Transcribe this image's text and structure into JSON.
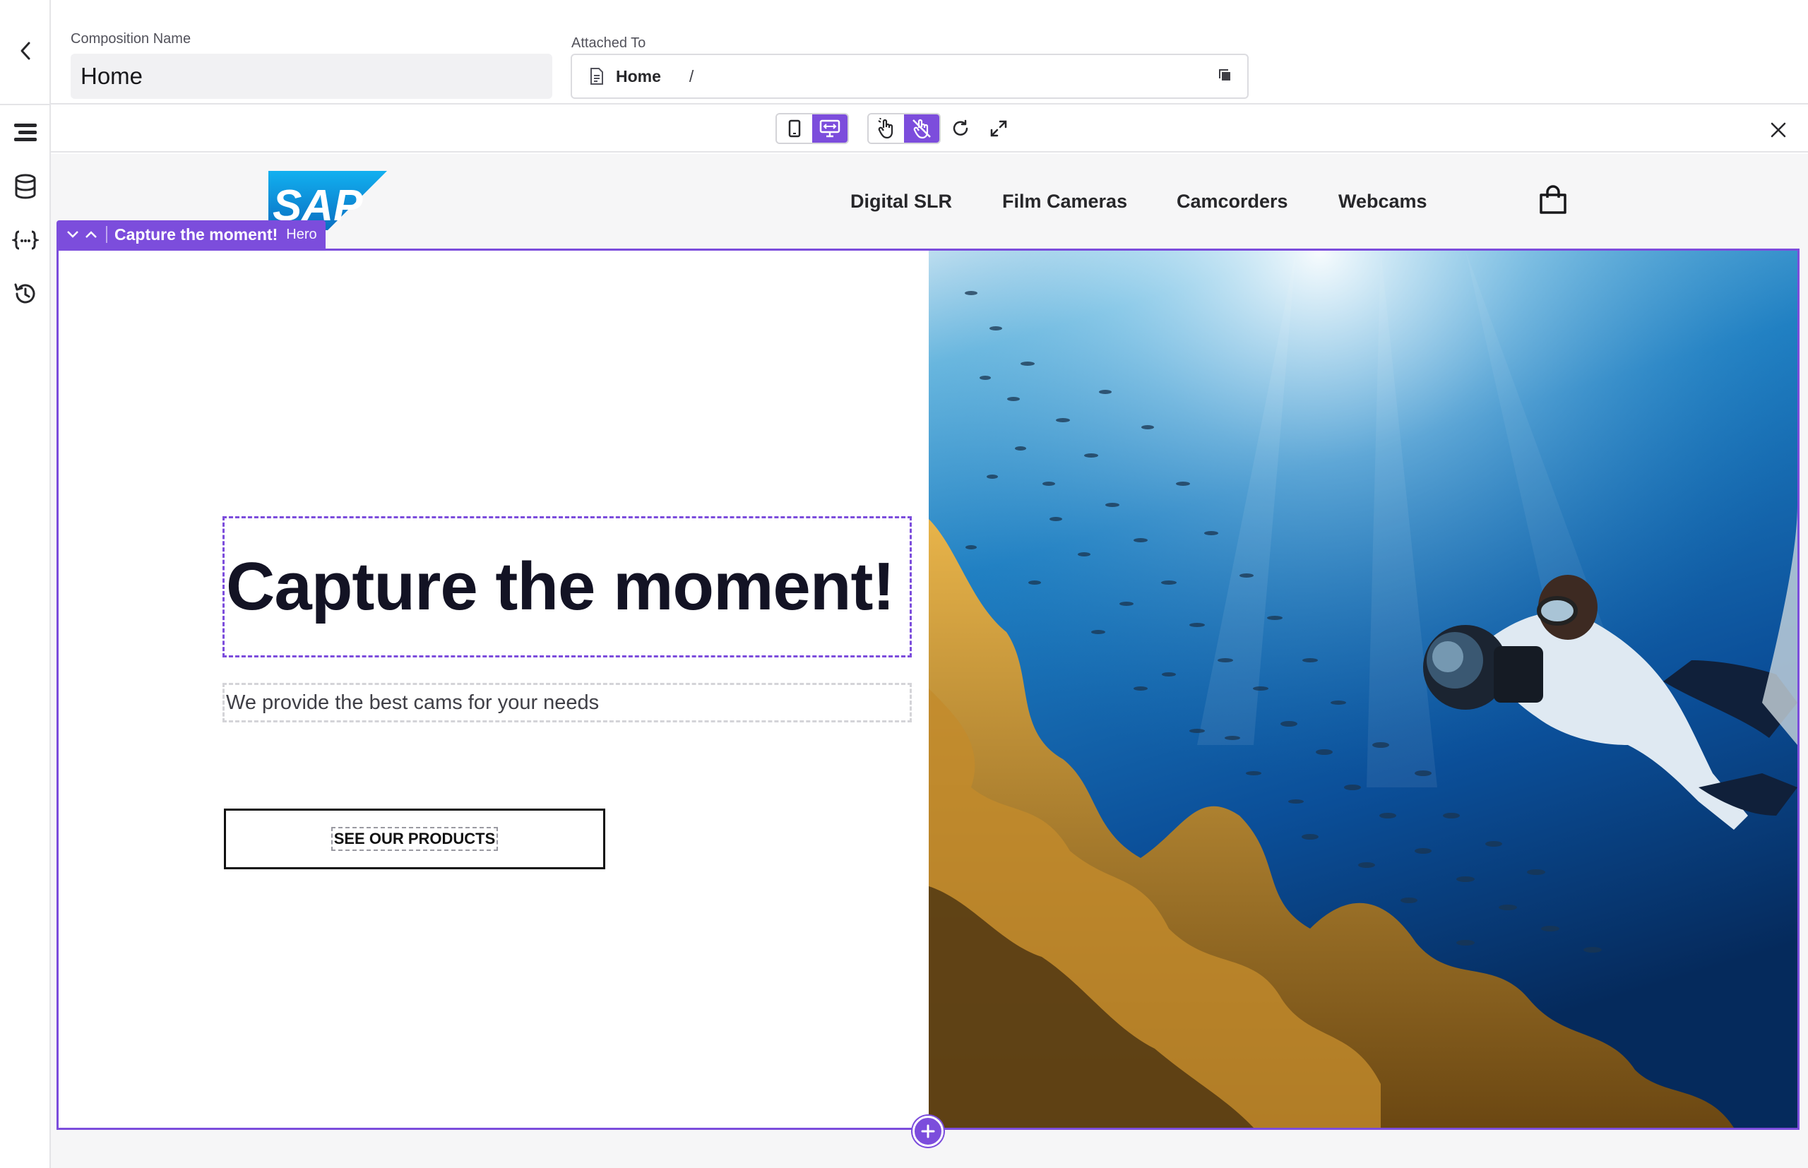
{
  "header": {
    "composition_label": "Composition Name",
    "composition_value": "Home",
    "attached_label": "Attached To",
    "attached_page": "Home",
    "attached_path": "/"
  },
  "rail": {
    "icons": [
      "structure-icon",
      "data-icon",
      "variables-icon",
      "history-icon"
    ]
  },
  "toolbar": {
    "viewport_modes": [
      "mobile",
      "desktop"
    ],
    "active_viewport": "desktop",
    "interaction_modes": [
      "interact",
      "select"
    ],
    "active_interaction": "select"
  },
  "site": {
    "logo": "SAP",
    "nav": [
      "Digital SLR",
      "Film Cameras",
      "Camcorders",
      "Webcams"
    ]
  },
  "hero": {
    "tag_name": "Capture the moment!",
    "tag_type": "Hero",
    "title": "Capture the moment!",
    "subtitle": "We provide the best cams for your needs",
    "cta": "SEE OUR PRODUCTS",
    "image_alt": "diver-photographing-coral-reef"
  },
  "colors": {
    "accent": "#7c4ddc",
    "sap_blue": "#0a8fd6"
  }
}
